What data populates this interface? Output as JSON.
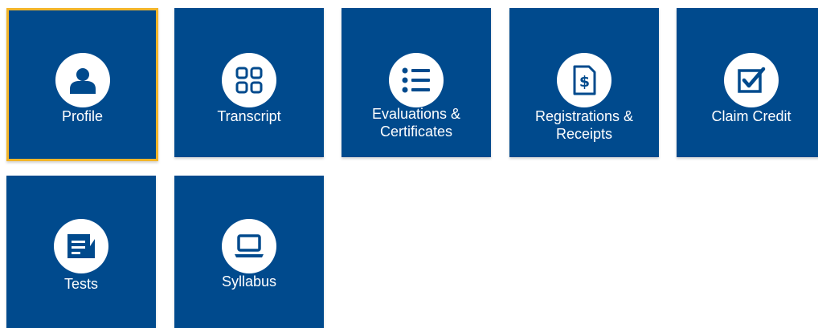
{
  "tiles": [
    {
      "label": "Profile",
      "icon": "user-icon"
    },
    {
      "label": "Transcript",
      "icon": "grid-icon"
    },
    {
      "label": "Evaluations & Certificates",
      "icon": "list-icon"
    },
    {
      "label": "Registrations & Receipts",
      "icon": "receipt-icon"
    },
    {
      "label": "Claim Credit",
      "icon": "checkbox-icon"
    },
    {
      "label": "Tests",
      "icon": "document-icon"
    },
    {
      "label": "Syllabus",
      "icon": "laptop-icon"
    }
  ],
  "colors": {
    "tile_background": "#004a8d",
    "icon_background": "#ffffff",
    "focus_outline": "#f2b52a",
    "label_text": "#ffffff"
  }
}
